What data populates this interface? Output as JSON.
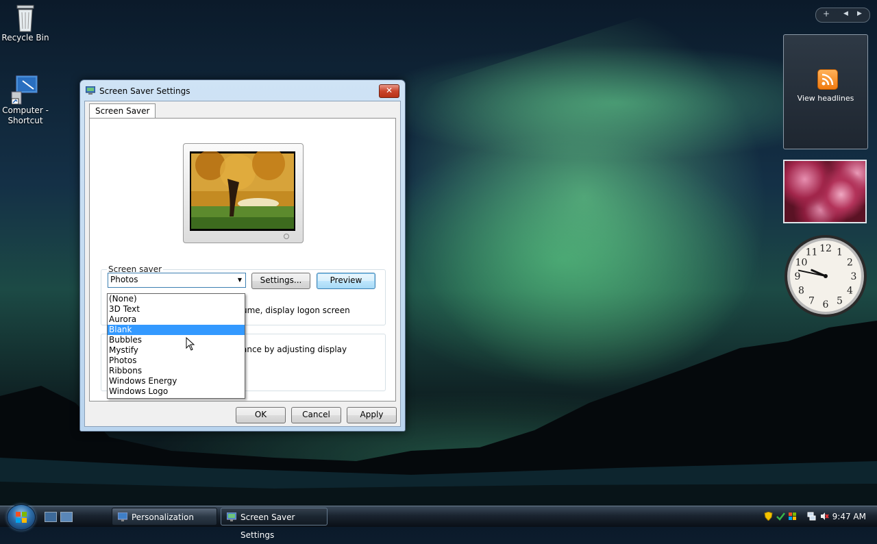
{
  "desktop": {
    "icons": [
      {
        "label": "Recycle Bin"
      },
      {
        "label_line1": "Computer -",
        "label_line2": "Shortcut"
      }
    ]
  },
  "dialog": {
    "title": "Screen Saver Settings",
    "close_label": "✕",
    "tab_label": "Screen Saver",
    "group_screensaver_legend": "Screen saver",
    "selected_screensaver": "Photos",
    "settings_button": "Settings...",
    "preview_button": "Preview",
    "resume_text_partial": "ume, display logon screen",
    "power_text_partial": "ance by adjusting display",
    "dropdown_options": [
      {
        "label": "(None)",
        "selected": false
      },
      {
        "label": "3D Text",
        "selected": false
      },
      {
        "label": "Aurora",
        "selected": false
      },
      {
        "label": "Blank",
        "selected": true
      },
      {
        "label": "Bubbles",
        "selected": false
      },
      {
        "label": "Mystify",
        "selected": false
      },
      {
        "label": "Photos",
        "selected": false
      },
      {
        "label": "Ribbons",
        "selected": false
      },
      {
        "label": "Windows Energy",
        "selected": false
      },
      {
        "label": "Windows Logo",
        "selected": false
      }
    ],
    "ok_button": "OK",
    "cancel_button": "Cancel",
    "apply_button": "Apply"
  },
  "sidebar": {
    "add_label": "+",
    "prev_label": "◀",
    "next_label": "▶",
    "feed_label": "View headlines",
    "clock_numbers": [
      "12",
      "1",
      "2",
      "3",
      "4",
      "5",
      "6",
      "7",
      "8",
      "9",
      "10",
      "11"
    ],
    "clock_time": {
      "hour": 9,
      "minute": 47
    }
  },
  "taskbar": {
    "buttons": [
      {
        "label": "Personalization",
        "active": false
      },
      {
        "label": "Screen Saver Settings",
        "active": true
      }
    ],
    "clock": "9:47 AM"
  },
  "colors": {
    "selection": "#3399ff",
    "rss_orange": "#f07a10",
    "close_red": "#c9442b"
  }
}
